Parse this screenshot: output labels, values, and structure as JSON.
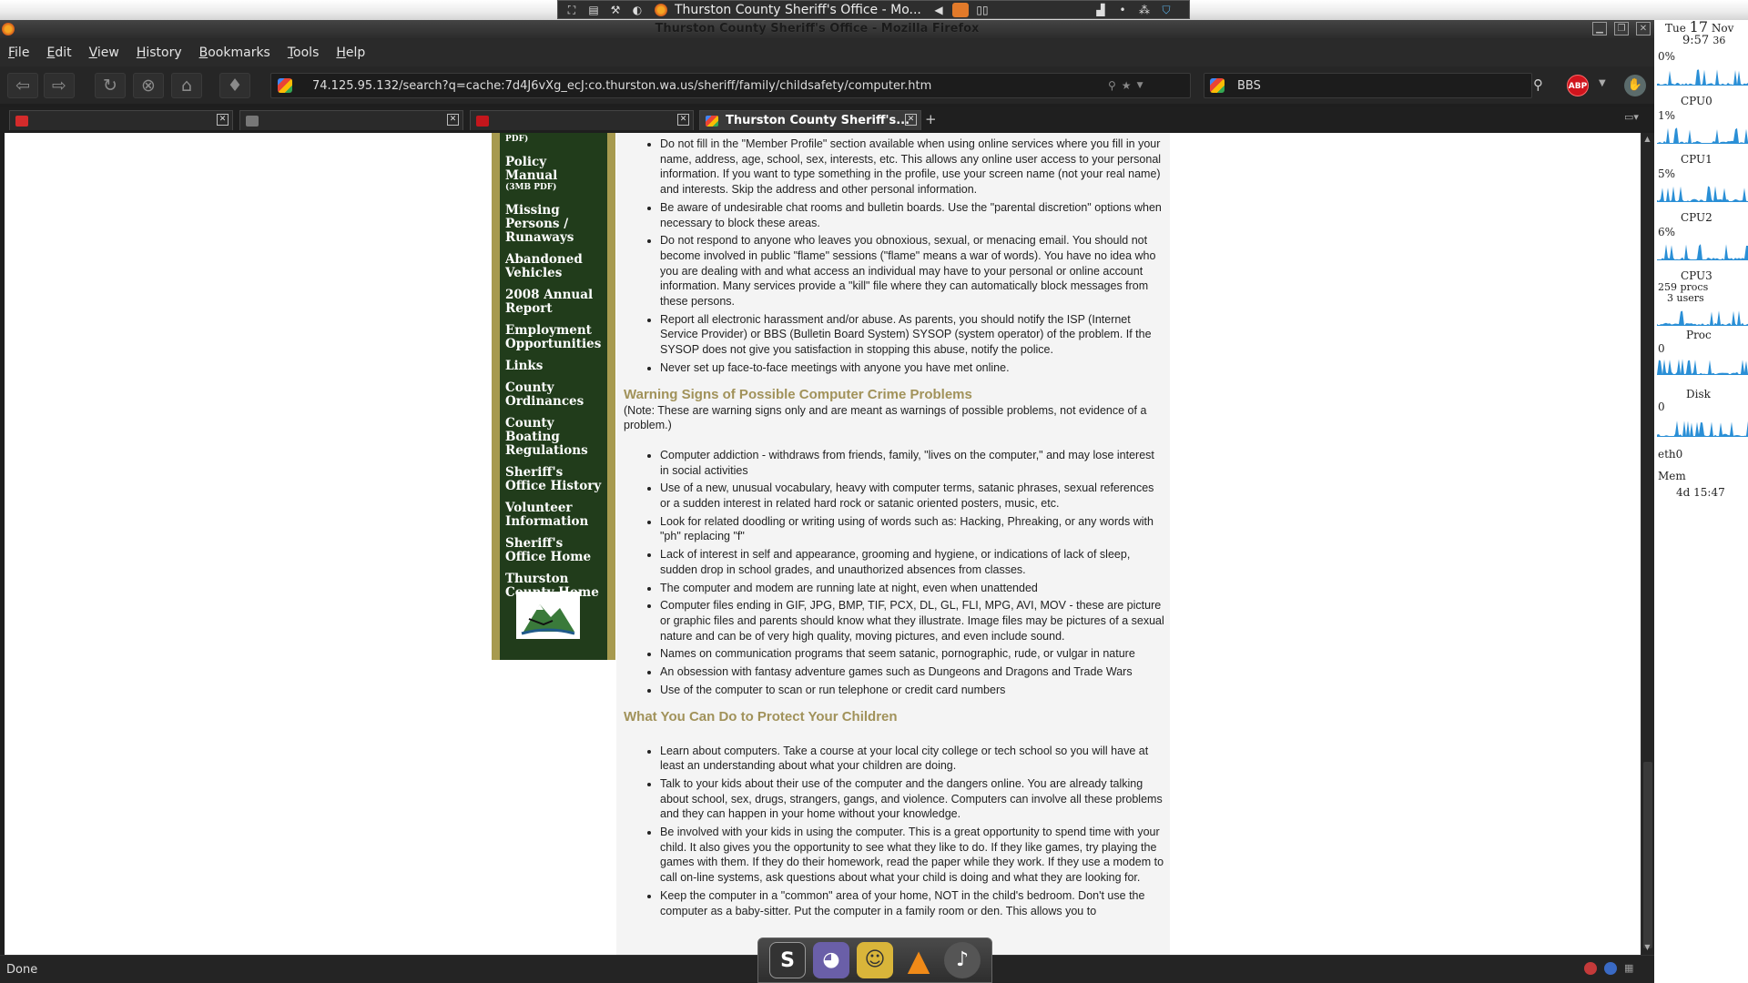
{
  "panel": {
    "title": "Thurston County Sheriff's Office - Mo...",
    "buttons": [
      "⛶",
      "▤",
      "⚒",
      "◐"
    ]
  },
  "window": {
    "title": "Thurston County Sheriff's Office - Mozilla Firefox"
  },
  "menu": [
    "File",
    "Edit",
    "View",
    "History",
    "Bookmarks",
    "Tools",
    "Help"
  ],
  "navbar": {
    "url": "74.125.95.132/search?q=cache:7d4J6vXg_ecJ:co.thurston.wa.us/sheriff/family/childsafety/computer.htm",
    "search_value": "BBS"
  },
  "tabs": [
    {
      "label": "",
      "color": "#d42b2b"
    },
    {
      "label": "",
      "color": "#777777"
    },
    {
      "label": "",
      "color": "#c4161c"
    },
    {
      "label": "Thurston County Sheriff's...",
      "color": "#4285f4"
    }
  ],
  "leftnav": {
    "items": [
      {
        "label": "PDF)",
        "small": true
      },
      {
        "label": "Policy Manual"
      },
      {
        "label": "(3MB PDF)",
        "small": true
      },
      {
        "label": "Missing Persons / Runaways"
      },
      {
        "label": "Abandoned Vehicles"
      },
      {
        "label": "2008 Annual Report"
      },
      {
        "label": "Employment Opportunities"
      },
      {
        "label": "Links"
      },
      {
        "label": "County Ordinances"
      },
      {
        "label": "County Boating Regulations"
      },
      {
        "label": "Sheriff's Office History"
      },
      {
        "label": "Volunteer Information"
      },
      {
        "label": "Sheriff's Office Home"
      },
      {
        "label": "Thurston County Home"
      }
    ]
  },
  "article": {
    "list1": [
      "Do not fill in the \"Member Profile\" section available when using online services where you fill in your name, address, age, school, sex, interests, etc. This allows any online user access to your personal information. If you want to type something in the profile, use your screen name (not your real name) and interests. Skip the address and other personal information.",
      "Be aware of undesirable chat rooms and bulletin boards. Use the \"parental discretion\" options when necessary to block these areas.",
      "Do not respond to anyone who leaves you obnoxious, sexual, or menacing email. You should not become involved in public \"flame\" sessions (\"flame\" means a war of words). You have no idea who you are dealing with and what access an individual may have to your personal or online account information. Many services provide a \"kill\" file where they can automatically block messages from these persons.",
      "Report all electronic harassment and/or abuse. As parents, you should notify the ISP (Internet Service Provider) or BBS (Bulletin Board System) SYSOP (system operator) of the problem. If the SYSOP does not give you satisfaction in stopping this abuse, notify the police.",
      "Never set up face-to-face meetings with anyone you have met online."
    ],
    "heading2": "Warning Signs of Possible Computer Crime Problems",
    "note2": "(Note: These are warning signs only and are meant as warnings of possible problems, not evidence of a problem.)",
    "list2": [
      "Computer addiction - withdraws from friends, family, \"lives on the computer,\" and may lose interest in social activities",
      "Use of a new, unusual vocabulary, heavy with computer terms, satanic phrases, sexual references or a sudden interest in related hard rock or satanic oriented posters, music, etc.",
      "Look for related doodling or writing using of words such as: Hacking, Phreaking, or any words with \"ph\" replacing \"f\"",
      "Lack of interest in self and appearance, grooming and hygiene, or indications of lack of sleep, sudden drop in school grades, and unauthorized absences from classes.",
      "The computer and modem are running late at night, even when unattended",
      "Computer files ending in GIF, JPG, BMP, TIF, PCX, DL, GL, FLI, MPG, AVI, MOV - these are picture or graphic files and parents should know what they illustrate. Image files may be pictures of a sexual nature and can be of very high quality, moving pictures, and even include sound.",
      "Names on communication programs that seem satanic, pornographic, rude, or vulgar in nature",
      "An obsession with fantasy adventure games such as Dungeons and Dragons and Trade Wars",
      "Use of the computer to scan or run telephone or credit card numbers"
    ],
    "heading3": "What You Can Do to Protect Your Children",
    "list3": [
      "Learn about computers. Take a course at your local city college or tech school so you will have at least an understanding about what your children are doing.",
      "Talk to your kids about their use of the computer and the dangers online. You are already talking about school, sex, drugs, strangers, gangs, and violence. Computers can involve all these problems and they can happen in your home without your knowledge.",
      "Be involved with your kids in using the computer. This is a great opportunity to spend time with your child. It also gives you the opportunity to see what they like to do. If they like games, try playing the games with them. If they do their homework, read the paper while they work. If they use a modem to call on-line systems, ask questions about what your child is doing and what they are looking for.",
      "Keep the computer in a \"common\" area of your home, NOT in the child's bedroom. Don't use the computer as a baby-sitter. Put the computer in a family room or den. This allows you to"
    ]
  },
  "status": {
    "text": "Done"
  },
  "monitor": {
    "day": "Tue",
    "date_num": "17",
    "month": "Nov",
    "time": "9:57",
    "seconds": "36",
    "cpu_pct": "0%",
    "cpu0_pct": "1%",
    "cpu1_pct": "5%",
    "cpu2_pct": "6%",
    "cpu0": "CPU0",
    "cpu1": "CPU1",
    "cpu2": "CPU2",
    "cpu3": "CPU3",
    "procs": "259 procs",
    "users": "3 users",
    "proc": "Proc",
    "proc_val": "0",
    "disk": "Disk",
    "disk_val": "0",
    "eth": "eth0",
    "mem": "Mem",
    "uptime": "4d 15:47"
  },
  "dock": [
    "S",
    "◕",
    "☺",
    "▲",
    "♪"
  ]
}
